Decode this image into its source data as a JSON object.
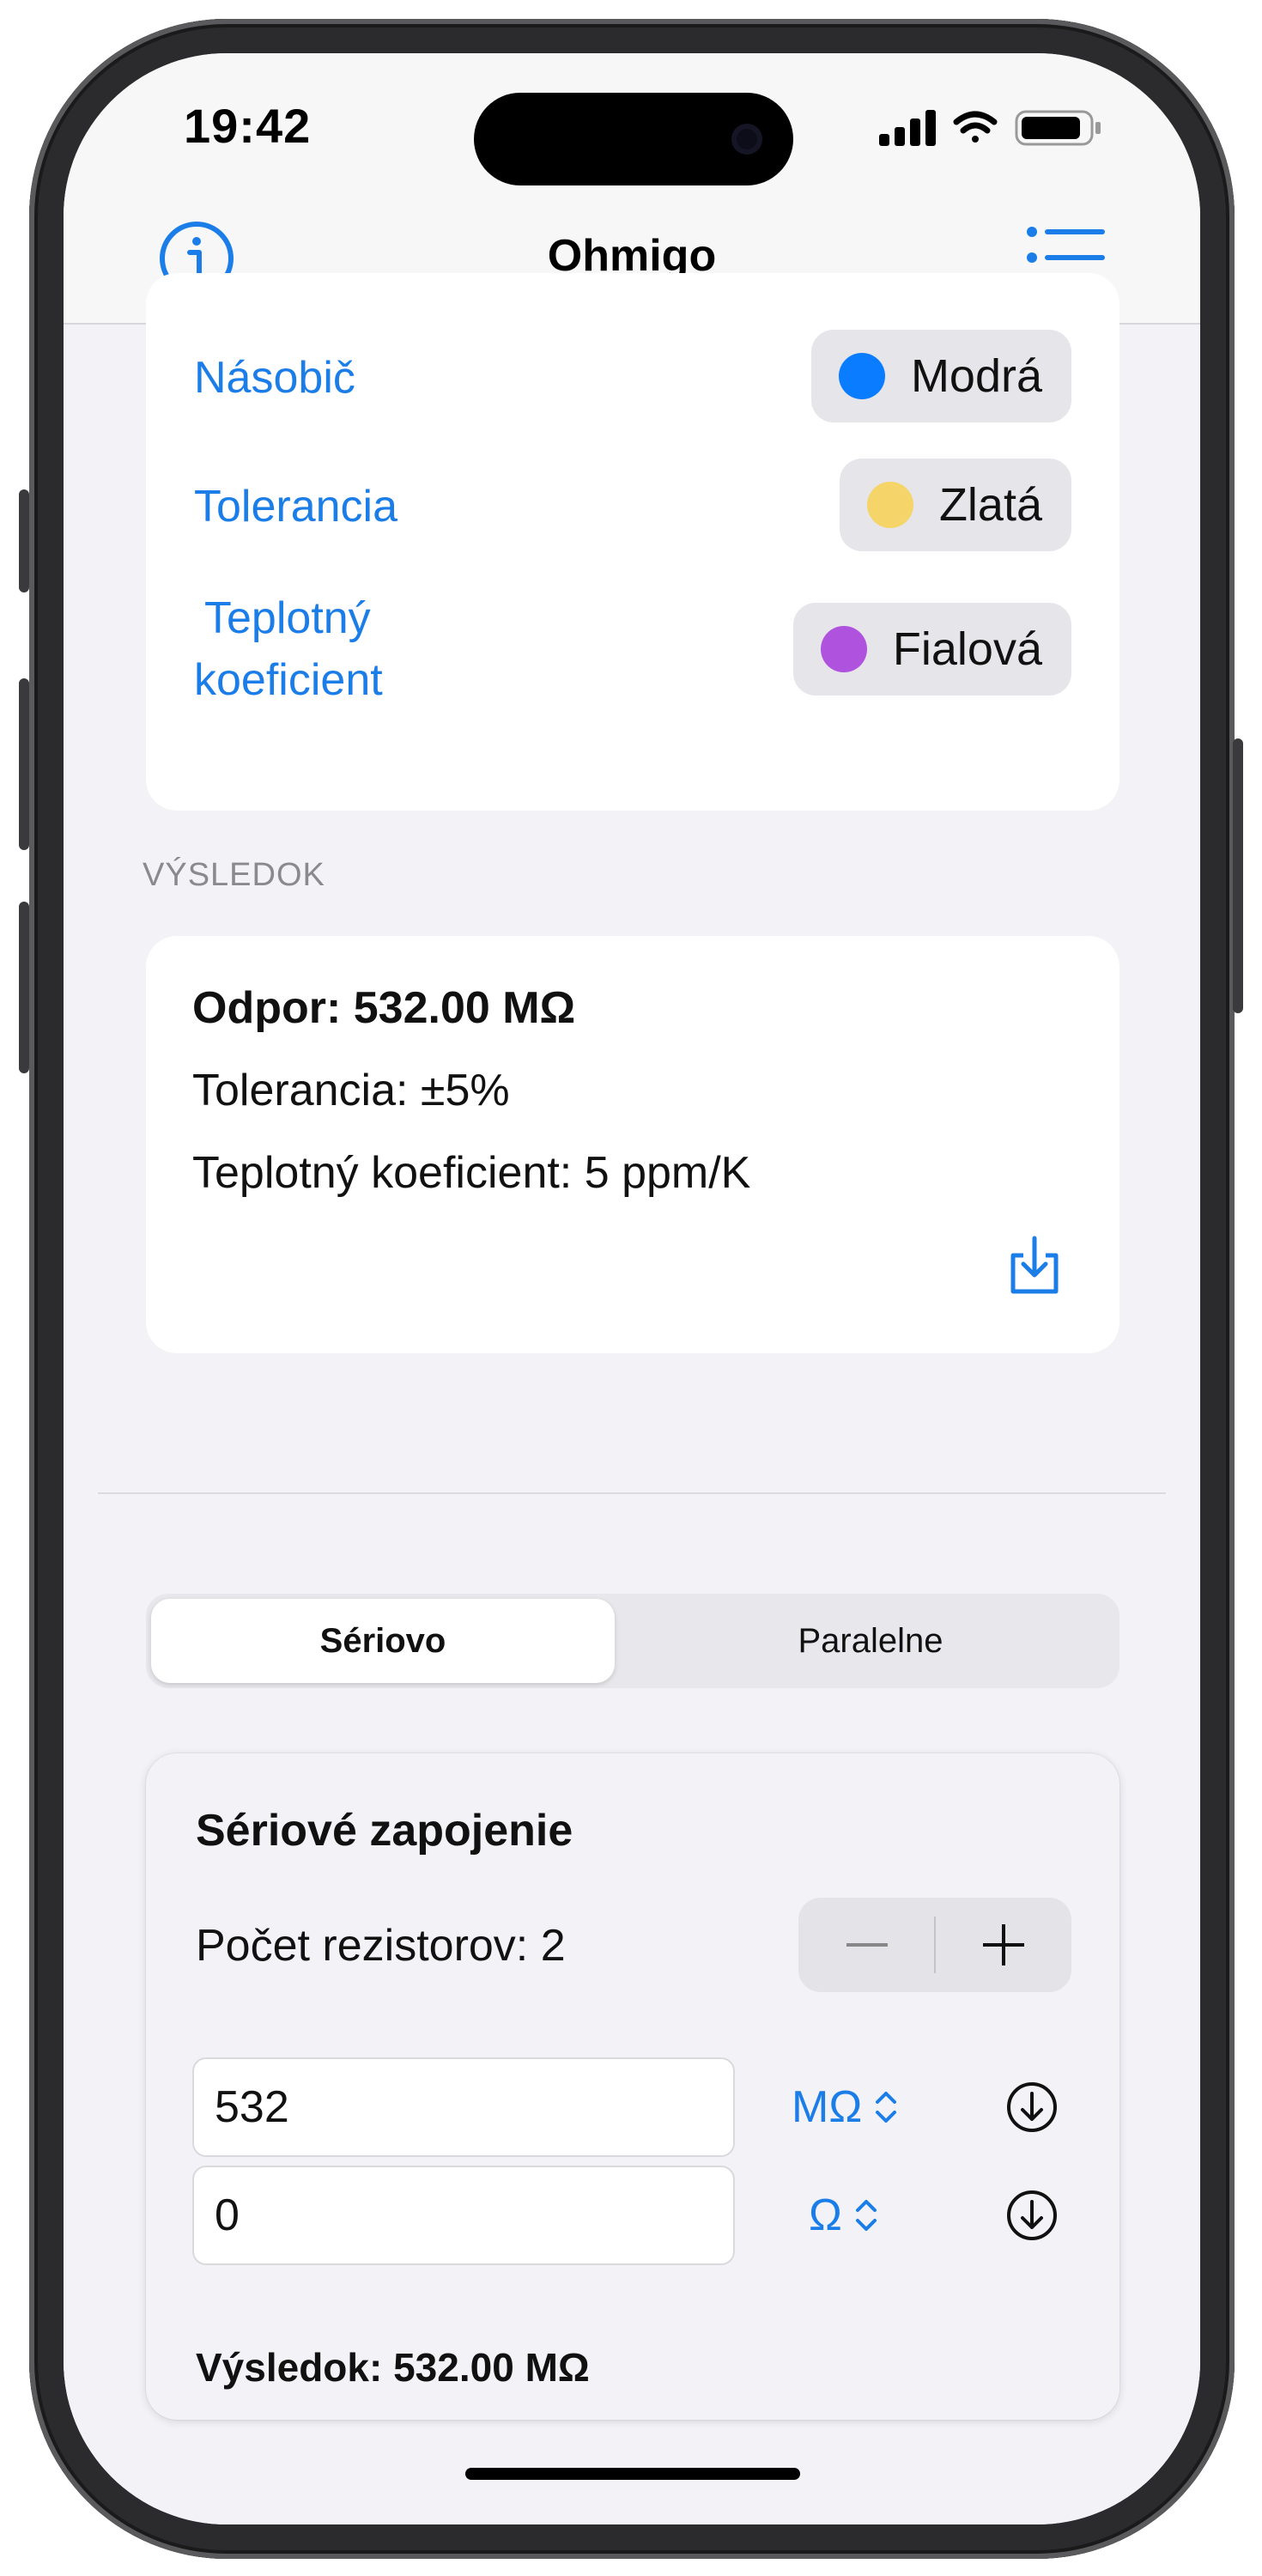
{
  "status_bar": {
    "time": "19:42"
  },
  "navbar": {
    "title": "Ohmigo",
    "info_icon": "info-circle-icon",
    "menu_icon": "list-icon"
  },
  "bands": [
    {
      "label": "Násobič",
      "color_name": "Modrá",
      "color": "#0a7cff"
    },
    {
      "label": "Tolerancia",
      "color_name": "Zlatá",
      "color": "#f5d469"
    },
    {
      "label_line1": "Teplotný",
      "label_line2": "koeficient",
      "color_name": "Fialová",
      "color": "#af52de"
    }
  ],
  "result_section": {
    "header": "VÝSLEDOK",
    "resistance": "Odpor: 532.00 MΩ",
    "tolerance": "Tolerancia: ±5%",
    "temp_coefficient": "Teplotný koeficient: 5 ppm/K",
    "save_icon": "tray-arrow-down-icon"
  },
  "connection_mode": {
    "options": [
      "Sériovo",
      "Paralelne"
    ],
    "selected": "Sériovo"
  },
  "series_card": {
    "title": "Sériové zapojenie",
    "count_label": "Počet rezistorov: 2",
    "stepper_minus": "−",
    "stepper_plus": "+",
    "resistors": [
      {
        "value": "532",
        "unit": "MΩ"
      },
      {
        "value": "0",
        "unit": "Ω"
      }
    ],
    "result": "Výsledok: 532.00 MΩ"
  },
  "colors": {
    "accent": "#1a7de8",
    "background": "#f2f2f7"
  }
}
